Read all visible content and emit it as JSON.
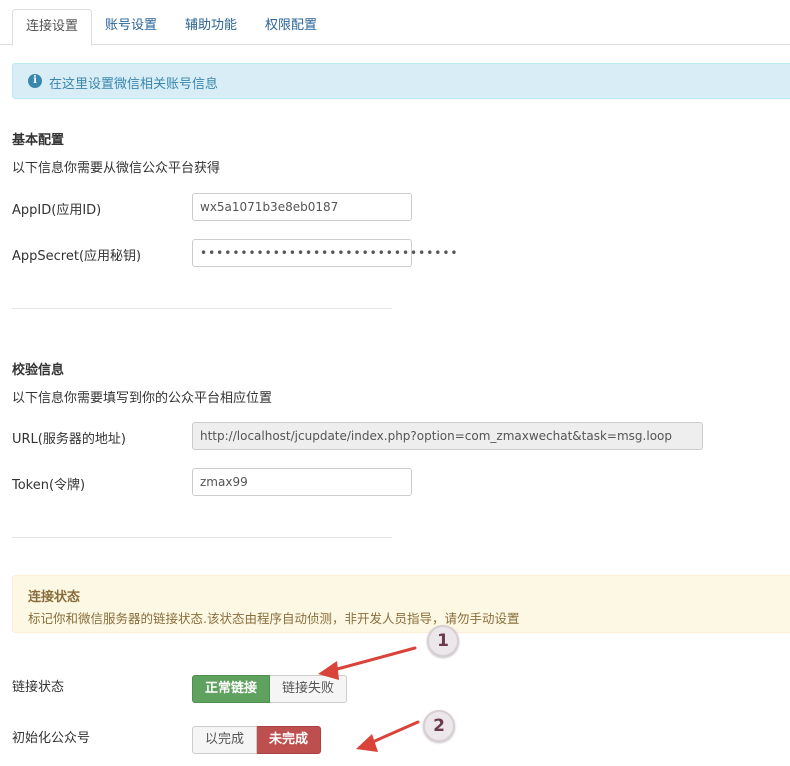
{
  "tabs": [
    {
      "label": "连接设置",
      "active": true
    },
    {
      "label": "账号设置",
      "active": false
    },
    {
      "label": "辅助功能",
      "active": false
    },
    {
      "label": "权限配置",
      "active": false
    }
  ],
  "info_alert": {
    "icon": "info-icon",
    "text": "在这里设置微信相关账号信息",
    "color": "#d9edf7"
  },
  "basic": {
    "title": "基本配置",
    "desc": "以下信息你需要从微信公众平台获得",
    "appid_label": "AppID(应用ID)",
    "appid_value": "wx5a1071b3e8eb0187",
    "appsecret_label": "AppSecret(应用秘钥)",
    "appsecret_value": "••••••••••••••••••••••••••••••••"
  },
  "verify": {
    "title": "校验信息",
    "desc": "以下信息你需要填写到你的公众平台相应位置",
    "url_label": "URL(服务器的地址)",
    "url_value": "http://localhost/jcupdate/index.php?option=com_zmaxwechat&task=msg.loop",
    "token_label": "Token(令牌)",
    "token_value": "zmax99"
  },
  "status_alert": {
    "title": "连接状态",
    "text": "标记你和微信服务器的链接状态.该状态由程序自动侦测，非开发人员指导，请勿手动设置",
    "color": "#fcf8e3"
  },
  "link_status": {
    "label": "链接状态",
    "options": [
      "正常链接",
      "链接失败"
    ],
    "selected": "正常链接",
    "selected_color": "#5fa15f"
  },
  "init_status": {
    "label": "初始化公众号",
    "options": [
      "以完成",
      "未完成"
    ],
    "selected": "未完成",
    "selected_color": "#bd4f4f"
  },
  "annotations": [
    {
      "number": "1"
    },
    {
      "number": "2"
    }
  ]
}
